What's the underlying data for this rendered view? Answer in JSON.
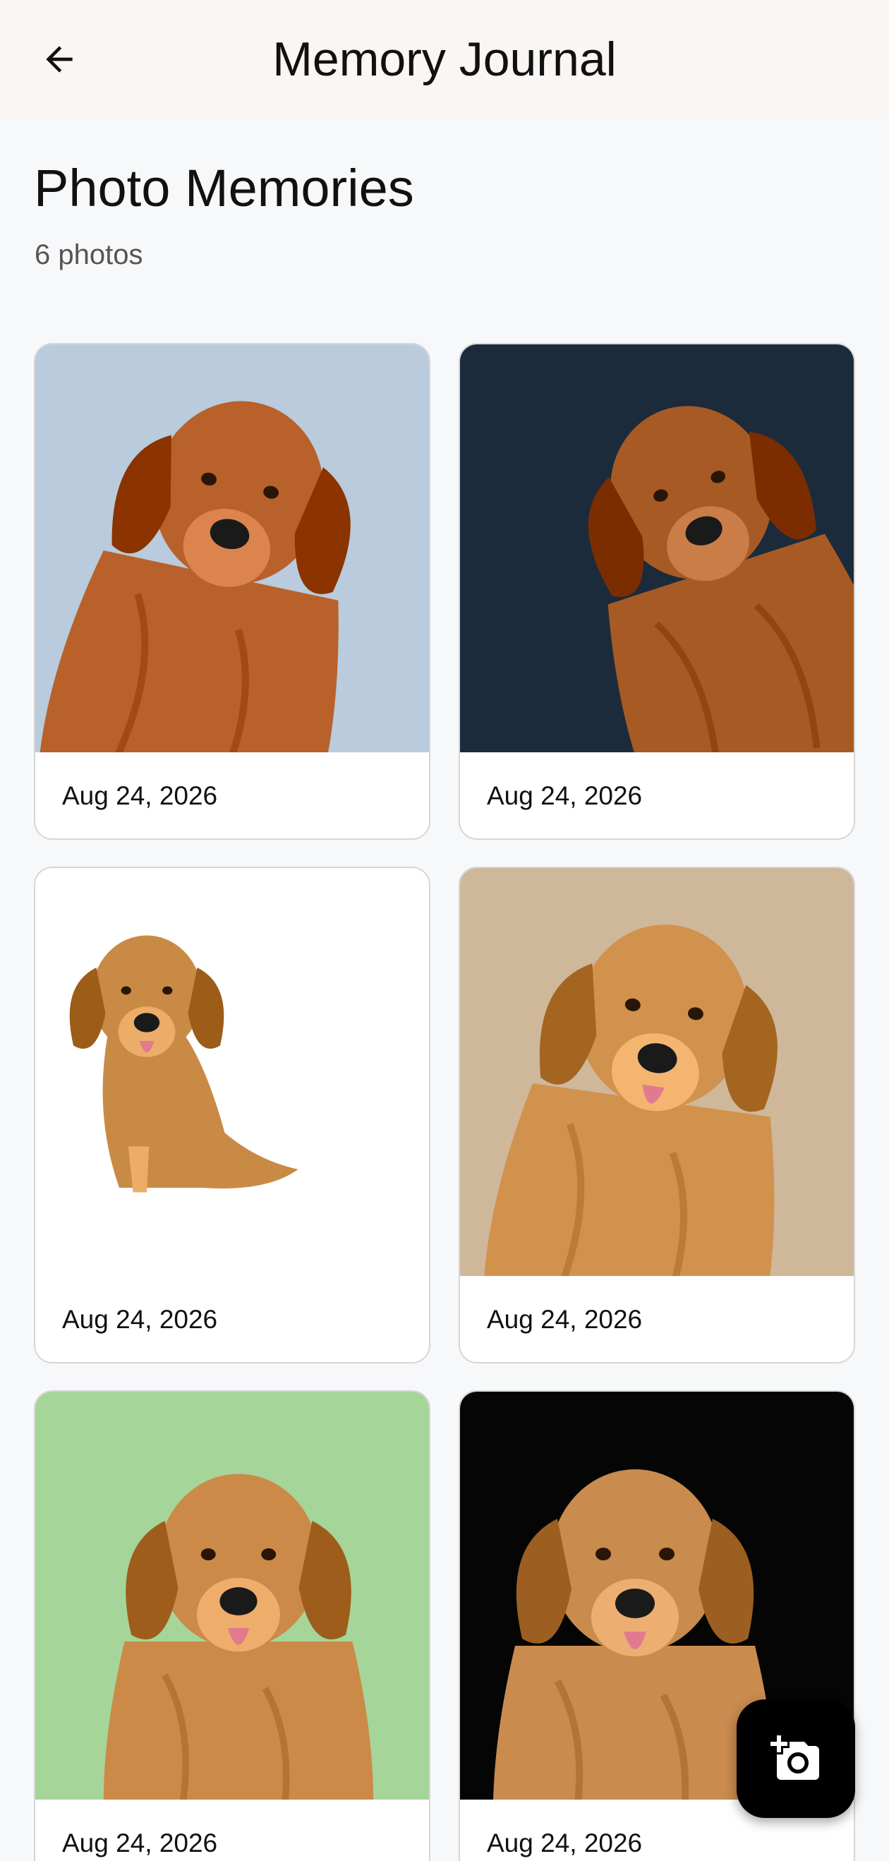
{
  "app_bar": {
    "title": "Memory Journal",
    "back_icon": "arrow-left-icon"
  },
  "header": {
    "title": "Photo Memories",
    "count": "6 photos"
  },
  "photos": [
    {
      "date": "Aug 24, 2026",
      "bg": "#b9cbdc",
      "fur": "#b8612a",
      "pose": "golden retriever portrait, light blue background"
    },
    {
      "date": "Aug 24, 2026",
      "bg": "#1c2b3c",
      "fur": "#a85a24",
      "pose": "golden retriever profile, dark blue background"
    },
    {
      "date": "Aug 24, 2026",
      "bg": "#ffffff",
      "fur": "#c98a45",
      "pose": "golden retriever sitting, white background"
    },
    {
      "date": "Aug 24, 2026",
      "bg": "#cfb79a",
      "fur": "#d1924e",
      "pose": "golden retriever outdoors, tan background"
    },
    {
      "date": "Aug 24, 2026",
      "bg": "#a6d59a",
      "fur": "#cb8a48",
      "pose": "golden retriever portrait, green background"
    },
    {
      "date": "Aug 24, 2026",
      "bg": "#050505",
      "fur": "#c98b4e",
      "pose": "golden retriever portrait, black background"
    }
  ],
  "fab": {
    "icon": "add-photo-camera-icon"
  }
}
